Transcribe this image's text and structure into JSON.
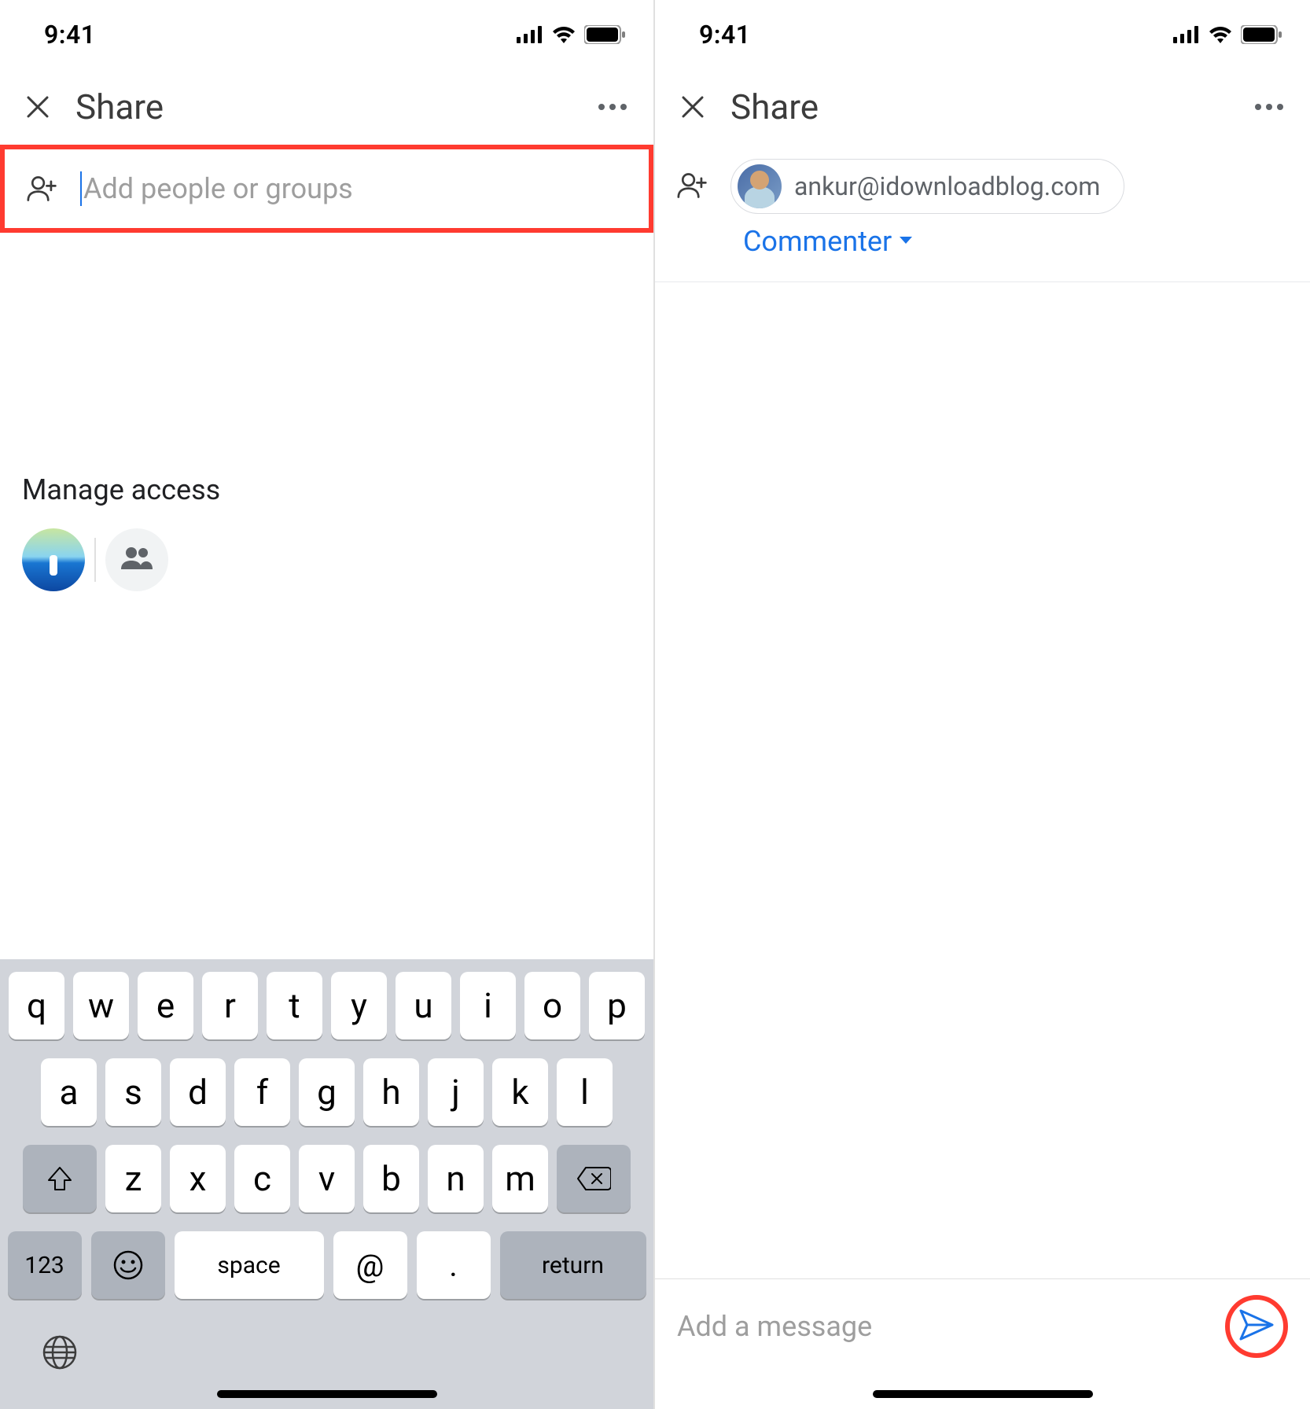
{
  "status": {
    "time": "9:41"
  },
  "left": {
    "header": {
      "title": "Share"
    },
    "input": {
      "placeholder": "Add people or groups"
    },
    "manage": {
      "title": "Manage access"
    },
    "keyboard": {
      "row1": [
        "q",
        "w",
        "e",
        "r",
        "t",
        "y",
        "u",
        "i",
        "o",
        "p"
      ],
      "row2": [
        "a",
        "s",
        "d",
        "f",
        "g",
        "h",
        "j",
        "k",
        "l"
      ],
      "row3": [
        "z",
        "x",
        "c",
        "v",
        "b",
        "n",
        "m"
      ],
      "num": "123",
      "space": "space",
      "at": "@",
      "dot": ".",
      "return": "return"
    }
  },
  "right": {
    "header": {
      "title": "Share"
    },
    "chip": {
      "email": "ankur@idownloadblog.com"
    },
    "role": {
      "label": "Commenter"
    },
    "message": {
      "placeholder": "Add a message"
    }
  }
}
